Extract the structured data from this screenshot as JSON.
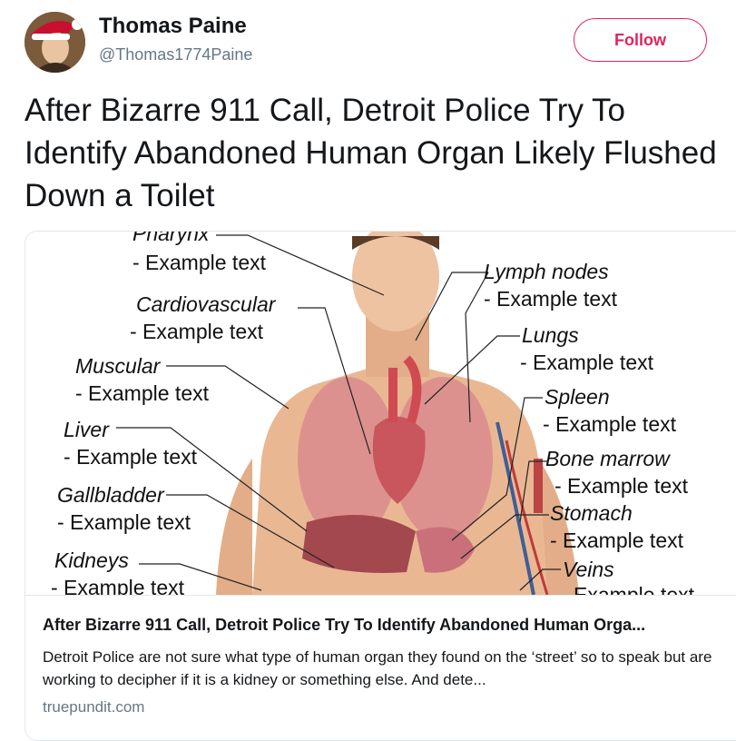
{
  "author": {
    "name": "Thomas Paine",
    "handle": "@Thomas1774Paine"
  },
  "follow_label": "Follow",
  "tweet_text": "After Bizarre 911 Call, Detroit Police Try To Identify Abandoned Human Organ Likely Flushed Down a Toilet",
  "card": {
    "title": "After Bizarre 911 Call, Detroit Police Try To Identify Abandoned Human Orga...",
    "description": "Detroit Police are not sure what type of human organ they found on the ‘street’ so to speak but are working to decipher if it is a kidney or something else. And dete...",
    "domain": "truepundit.com",
    "image_labels": {
      "left": [
        {
          "heading": "Pharynx",
          "text": "- Example text"
        },
        {
          "heading": "Cardiovascular",
          "text": "- Example text"
        },
        {
          "heading": "Muscular",
          "text": "- Example text"
        },
        {
          "heading": "Liver",
          "text": "- Example text"
        },
        {
          "heading": "Gallbladder",
          "text": "- Example text"
        },
        {
          "heading": "Kidneys",
          "text": "- Example text"
        }
      ],
      "right": [
        {
          "heading": "Lymph nodes",
          "text": "- Example text"
        },
        {
          "heading": "Lungs",
          "text": "- Example text"
        },
        {
          "heading": "Spleen",
          "text": "- Example text"
        },
        {
          "heading": "Bone marrow",
          "text": "- Example text"
        },
        {
          "heading": "Stomach",
          "text": "- Example text"
        },
        {
          "heading": "Veins",
          "text": "- Example text"
        }
      ]
    }
  },
  "colors": {
    "follow_accent": "#e0245e",
    "secondary_text": "#657786",
    "border": "#e1e8ed"
  }
}
